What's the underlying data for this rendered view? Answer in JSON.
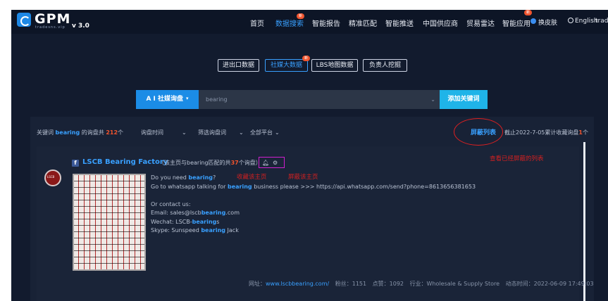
{
  "brand": {
    "name": "GPM",
    "sub": "tradesns.vip",
    "version": "v 3.0"
  },
  "nav": [
    {
      "label": "首页"
    },
    {
      "label": "数据搜索",
      "badge": "新",
      "active": true
    },
    {
      "label": "智能报告"
    },
    {
      "label": "精准匹配"
    },
    {
      "label": "智能推送"
    },
    {
      "label": "中国供应商"
    },
    {
      "label": "贸易雷达"
    },
    {
      "label": "智能应用",
      "badge": "新"
    },
    {
      "label": "换皮肤"
    },
    {
      "label": "English"
    },
    {
      "label": "trad..."
    }
  ],
  "sub_tabs": [
    {
      "label": "进出口数据"
    },
    {
      "label": "社媒大数据",
      "active": true,
      "badge": "新"
    },
    {
      "label": "LBS地图数据"
    },
    {
      "label": "负责人挖掘"
    }
  ],
  "search": {
    "mode_label": "A I 社媒询盘",
    "value": "bearing",
    "add_label": "添加关键词"
  },
  "filters": {
    "kw_prefix": "关键词",
    "kw": "bearing",
    "kw_mid": "的询盘共",
    "count": "212",
    "count_suffix": "个",
    "time_label": "询盘时间",
    "filter_label": "筛选询盘词",
    "platform_label": "全部平台",
    "block_list_label": "屏蔽列表",
    "deadline_prefix": "截止2022-7-05累计收藏询盘",
    "fav_count": "1",
    "fav_suffix": "个"
  },
  "annotations": {
    "a1": "查看已经屏蔽的列表",
    "a2": "收藏该主页",
    "a3": "屏蔽该主页"
  },
  "result": {
    "page_name": "LSCB Bearing Factory",
    "match_pre": "（该主页与bearing匹配的共",
    "match_count": "37",
    "match_post": "个询盘）",
    "line1_pre": "Do you need ",
    "line1_hl": "bearing",
    "line1_post": "?",
    "line2_pre": "Go to whatsapp talking for ",
    "line2_hl": "bearing",
    "line2_post": " business please >>> https://api.whatsapp.com/send?phone=8613656381653",
    "line3": "Or contact us:",
    "line4_pre": "Email: sales@lscb",
    "line4_hl": "bearing",
    "line4_post": ".com",
    "line5_pre": "Wechat: LSCB-",
    "line5_hl": "bearing",
    "line5_post": "s",
    "line6_pre": "Skype: Sunspeed ",
    "line6_hl": "bearing",
    "line6_post": " Jack",
    "site_label": "网址：",
    "site": "www.lscbbearing.com/",
    "fans": "粉丝：1151",
    "likes": "点赞：1092",
    "industry": "行业：Wholesale & Supply Store",
    "activity": "动态时间：2022-06-09 17:49:03"
  }
}
